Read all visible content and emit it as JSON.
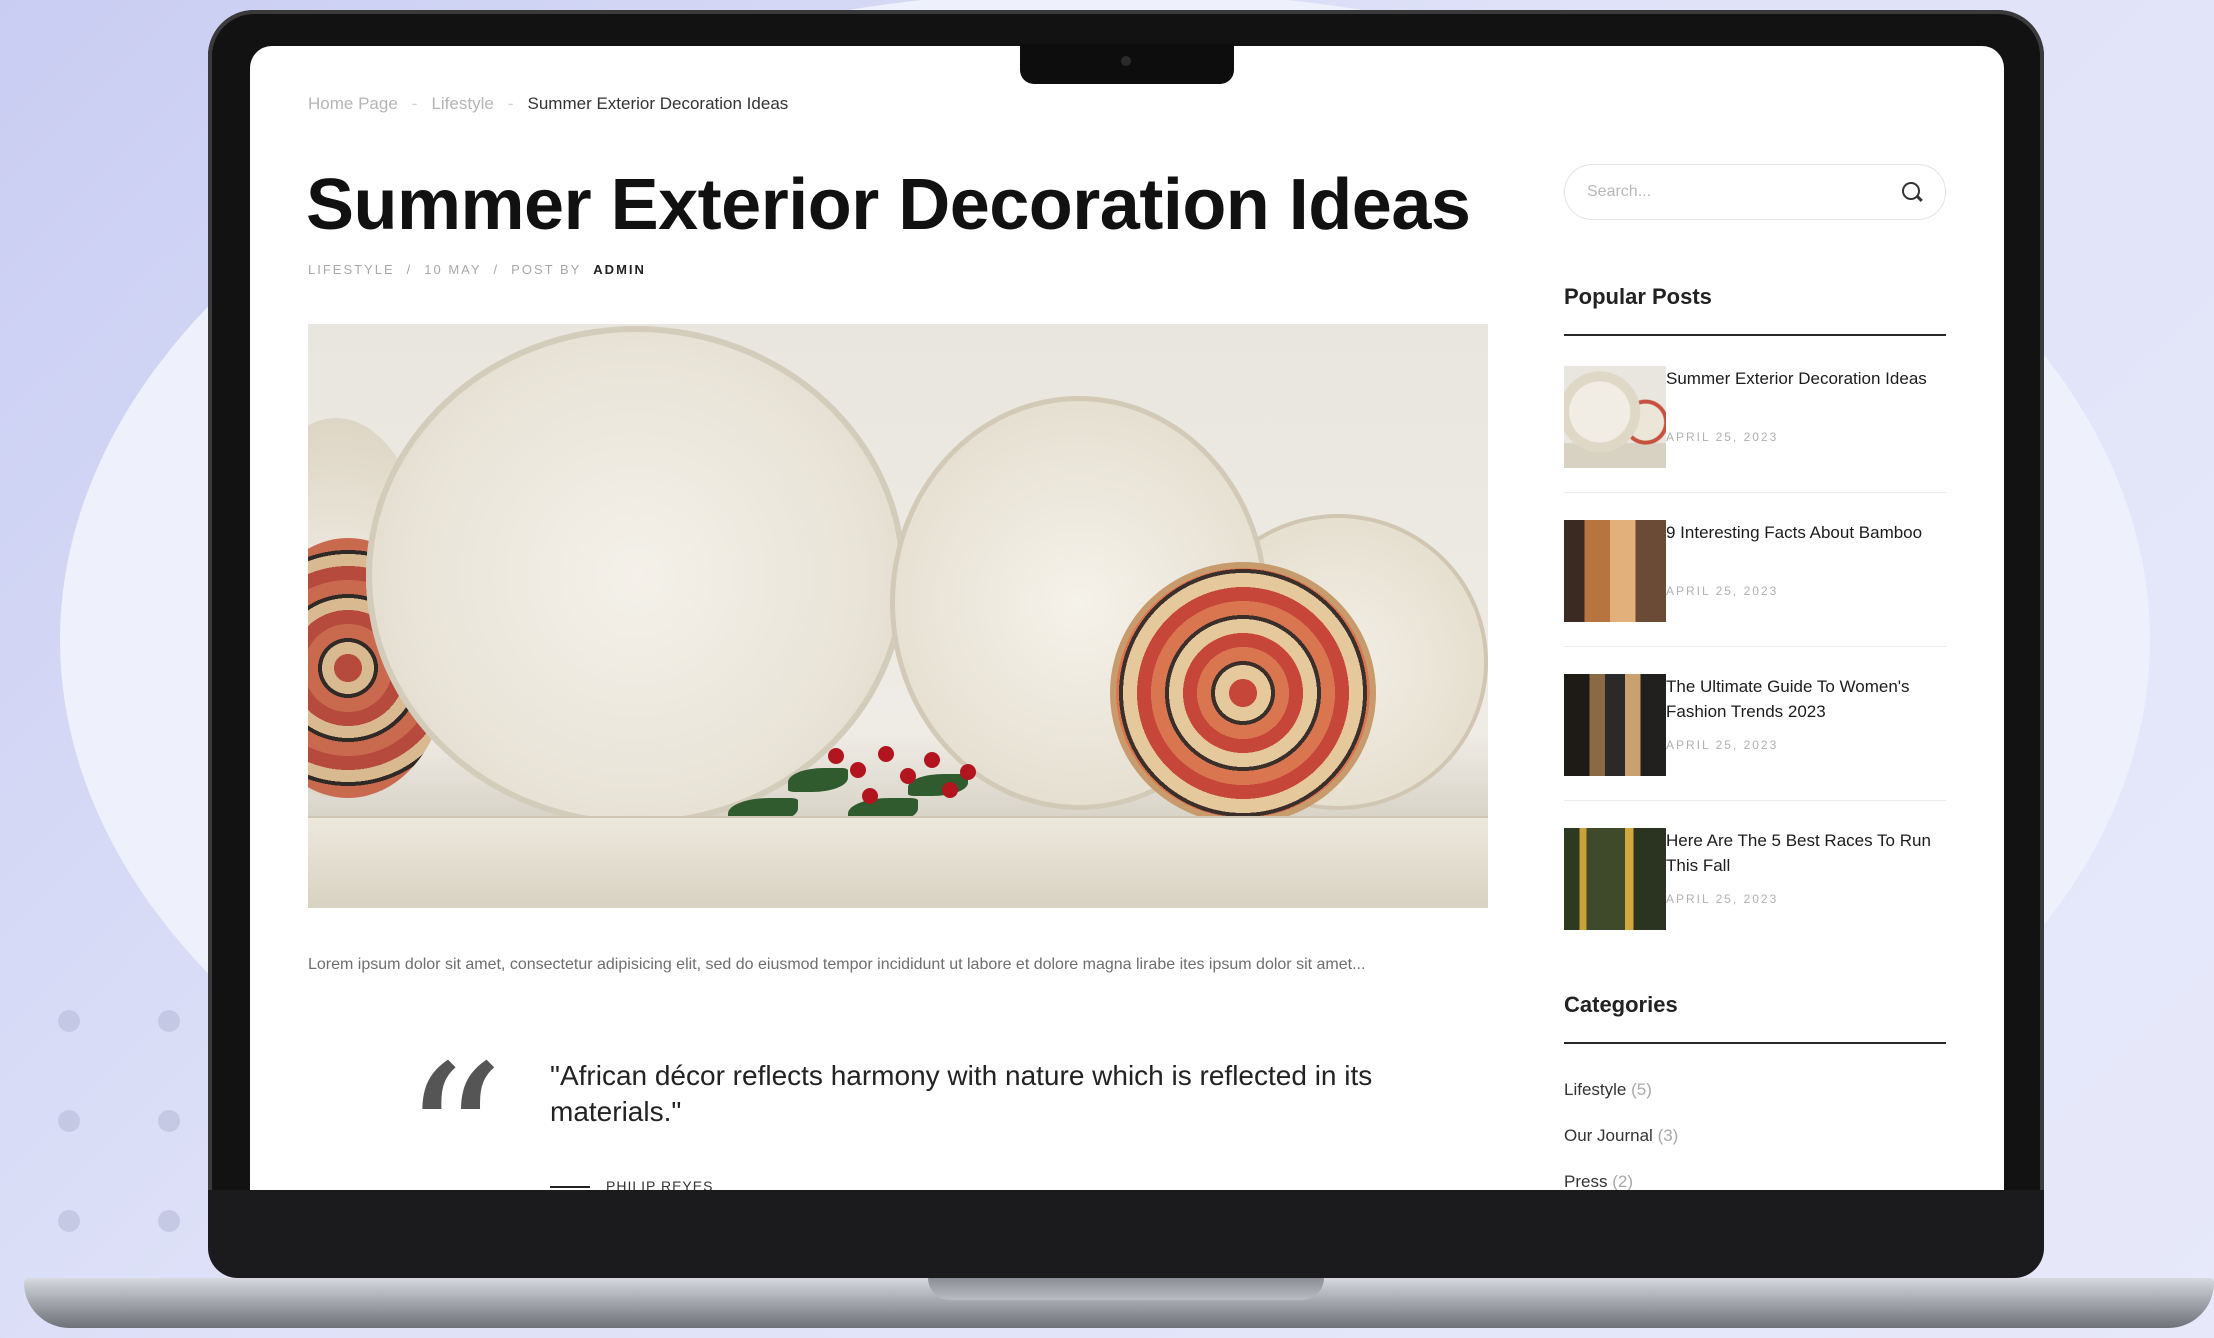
{
  "breadcrumb": {
    "home": "Home Page",
    "section": "Lifestyle",
    "current": "Summer Exterior Decoration Ideas"
  },
  "post": {
    "title": "Summer Exterior Decoration Ideas",
    "category": "LIFESTYLE",
    "date": "10 MAY",
    "posted_by": "POST BY",
    "author": "ADMIN",
    "excerpt": "Lorem ipsum dolor sit amet, consectetur adipisicing elit, sed do eiusmod tempor incididunt ut labore et dolore magna lirabe ites ipsum dolor sit amet...",
    "quote": "\"African décor reflects harmony with nature which is reflected in its materials.\"",
    "quote_author": "PHILIP REYES"
  },
  "sidebar": {
    "search_placeholder": "Search...",
    "popular_heading": "Popular Posts",
    "popular_posts": [
      {
        "title": "Summer Exterior Decoration Ideas",
        "date": "APRIL 25, 2023"
      },
      {
        "title": "9 Interesting Facts About Bamboo",
        "date": "APRIL 25, 2023"
      },
      {
        "title": "The Ultimate Guide To Women's Fashion Trends 2023",
        "date": "APRIL 25, 2023"
      },
      {
        "title": "Here Are The 5 Best Races To Run This Fall",
        "date": "APRIL 25, 2023"
      }
    ],
    "categories_heading": "Categories",
    "categories": [
      {
        "name": "Lifestyle",
        "count": "(5)"
      },
      {
        "name": "Our Journal",
        "count": "(3)"
      },
      {
        "name": "Press",
        "count": "(2)"
      }
    ]
  },
  "icons": {
    "search": "search-icon",
    "quote": "quote-icon"
  },
  "colors": {
    "background": "#dfe2f8",
    "laptop_frame": "#121212",
    "text_primary": "#111111",
    "text_muted": "#a8a8a8"
  }
}
